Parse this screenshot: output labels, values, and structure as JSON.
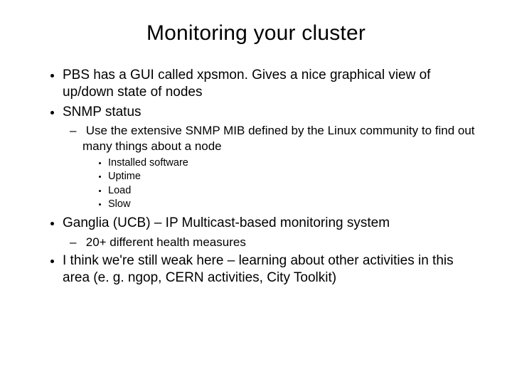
{
  "title": "Monitoring your cluster",
  "bullets": {
    "b1": "PBS has a GUI called xpsmon. Gives a nice graphical view of up/down state of nodes",
    "b2": "SNMP status",
    "b2_1": "Use the extensive SNMP MIB defined by the Linux community to find out many things about a node",
    "b2_1_1": "Installed software",
    "b2_1_2": "Uptime",
    "b2_1_3": "Load",
    "b2_1_4": "Slow",
    "b3": "Ganglia (UCB) – IP Multicast-based monitoring system",
    "b3_1": "20+ different health measures",
    "b4": "I think we're still weak here – learning about other activities in this area (e. g. ngop, CERN activities, City Toolkit)"
  }
}
